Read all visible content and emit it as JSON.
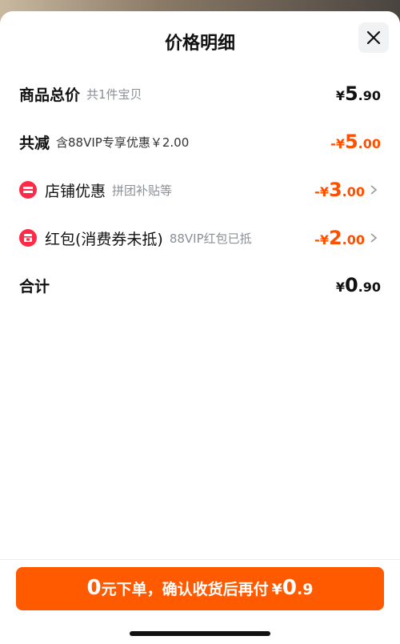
{
  "sheet": {
    "title": "价格明细",
    "close_icon": "close-icon"
  },
  "rows": {
    "total_price": {
      "label": "商品总价",
      "sub": "共1件宝贝",
      "currency": "¥",
      "int": "5",
      "dec": ".90"
    },
    "total_reduction": {
      "label": "共减",
      "sub": "含88VIP专享优惠￥2.00",
      "currency": "-¥",
      "int": "5",
      "dec": ".00"
    },
    "store_discount": {
      "label": "店铺优惠",
      "sub": "拼团补贴等",
      "currency": "-¥",
      "int": "3",
      "dec": ".00",
      "icon": "store-discount-icon"
    },
    "red_packet": {
      "label": "红包(消费券未抵)",
      "sub": "88VIP红包已抵",
      "currency": "-¥",
      "int": "2",
      "dec": ".00",
      "icon": "red-packet-icon"
    },
    "sum": {
      "label": "合计",
      "currency": "¥",
      "int": "0",
      "dec": ".90"
    }
  },
  "cta": {
    "prefix_num": "0",
    "text": "元下单，确认收货后再付",
    "currency": "¥",
    "int": "0",
    "dec": ".9"
  },
  "colors": {
    "accent": "#ff5000",
    "button": "#ff5a00",
    "icon_red": "#ff2a47"
  }
}
